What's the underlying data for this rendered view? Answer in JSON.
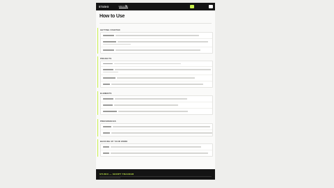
{
  "header": {
    "brand": "STUDIO",
    "nav": [
      {
        "label": "How to Use"
      },
      {
        "label": ""
      },
      {
        "label": ""
      },
      {
        "label": ""
      }
    ],
    "cta_label": "",
    "secondary_label": ""
  },
  "page": {
    "title": "How to Use",
    "subtitle": ""
  },
  "sections": [
    {
      "title": "GETTING STARTED",
      "rows": [
        {
          "label": "",
          "desc": ""
        },
        {
          "label": "",
          "desc": ""
        },
        {
          "label": "",
          "desc": ""
        }
      ]
    },
    {
      "title": "PROJECTS",
      "rows": [
        {
          "label": "",
          "desc": ""
        },
        {
          "label": "",
          "desc": ""
        },
        {
          "label": "",
          "desc": ""
        },
        {
          "label": "",
          "desc": ""
        }
      ]
    },
    {
      "title": "ELEMENTS",
      "rows": [
        {
          "label": "",
          "desc": ""
        },
        {
          "label": "",
          "desc": ""
        },
        {
          "label": "",
          "desc": ""
        }
      ]
    },
    {
      "title": "PREFERENCES",
      "rows": [
        {
          "label": "",
          "desc": ""
        },
        {
          "label": "",
          "desc": ""
        }
      ]
    },
    {
      "title": "BACKING UP YOUR WORK",
      "rows": [
        {
          "label": "",
          "desc": ""
        },
        {
          "label": "",
          "desc": ""
        }
      ]
    }
  ],
  "note": "",
  "footer": {
    "brand": "STUDIO — SCRIPT TRACKER",
    "copyright": ""
  }
}
